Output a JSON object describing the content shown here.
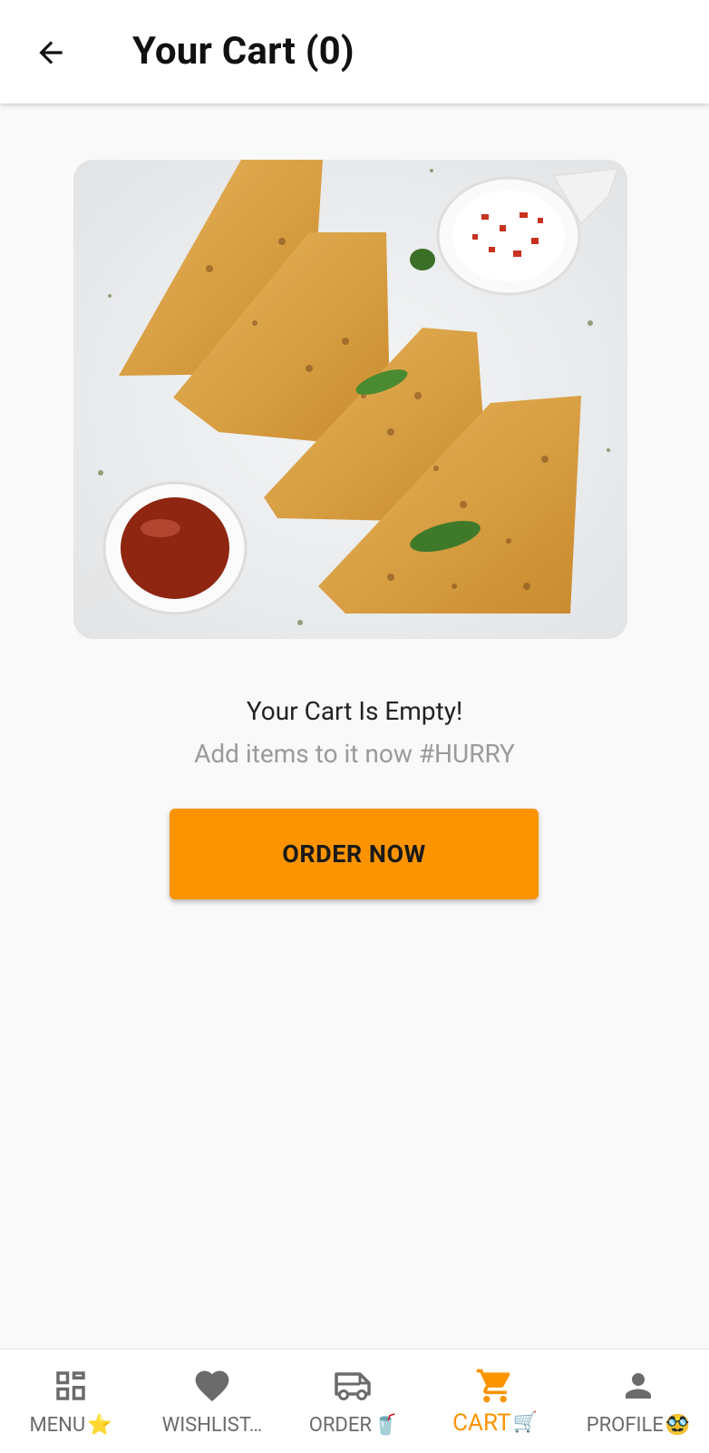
{
  "header": {
    "title": "Your Cart (0)",
    "back_icon": "arrow-left-icon"
  },
  "empty_state": {
    "title": "Your Cart Is Empty!",
    "subtitle": "Add items to it now #HURRY",
    "button_label": "ORDER NOW"
  },
  "colors": {
    "accent": "#fb9400",
    "nav_inactive": "#6b6b6b",
    "background": "#f9f9f9"
  },
  "bottom_nav": {
    "items": [
      {
        "label": "MENU",
        "emoji": "⭐",
        "icon": "menu-grid-icon",
        "active": false
      },
      {
        "label": "WISHLIST…",
        "emoji": "",
        "icon": "heart-icon",
        "active": false
      },
      {
        "label": "ORDER",
        "emoji": "🥤",
        "icon": "delivery-van-icon",
        "active": false
      },
      {
        "label": "CART",
        "emoji": "🛒",
        "icon": "shopping-cart-icon",
        "active": true
      },
      {
        "label": "PROFILE",
        "emoji": "🥸",
        "icon": "person-icon",
        "active": false
      }
    ]
  }
}
